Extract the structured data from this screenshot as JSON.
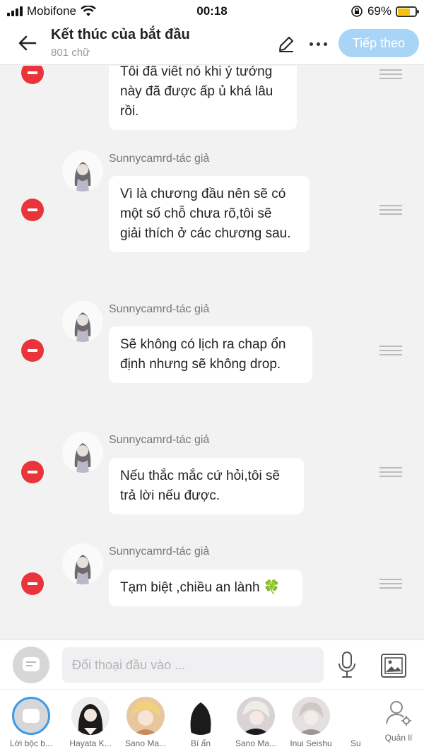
{
  "status_bar": {
    "carrier": "Mobifone",
    "time": "00:18",
    "battery": "69%",
    "battery_level": 0.69,
    "icons": [
      "signal-icon",
      "wifi-icon",
      "rotation-lock-icon",
      "battery-icon"
    ]
  },
  "header": {
    "title": "Kết thúc của bắt đầu",
    "subtitle": "801 chữ",
    "next_label": "Tiếp theo",
    "accent": "#a8d4f5"
  },
  "messages": [
    {
      "author": "",
      "lines": [
        "Tôi đã viết nó khi ý tưởng",
        "này đã được ấp ủ khá lâu",
        "rồi."
      ]
    },
    {
      "author": "Sunnycamrd-tác giả",
      "lines": [
        "Vì là chương đầu nên sẽ có",
        "một số chỗ chưa rõ,tôi sẽ",
        "giải thích ở các chương sau."
      ]
    },
    {
      "author": "Sunnycamrd-tác giả",
      "lines": [
        "Sẽ không có lịch ra chap ổn",
        "định nhưng sẽ không drop."
      ]
    },
    {
      "author": "Sunnycamrd-tác giả",
      "lines": [
        "Nếu thắc mắc cứ hỏi,tôi sẽ",
        "trả lời nếu được."
      ]
    },
    {
      "author": "Sunnycamrd-tác giả",
      "lines": [
        "Tạm biệt ,chiều an lành 🍀"
      ]
    }
  ],
  "input": {
    "placeholder": "Đối thoại đầu vào ..."
  },
  "characters": [
    {
      "name": "Lời bộc b..."
    },
    {
      "name": "Hayata K..."
    },
    {
      "name": "Sano Ma..."
    },
    {
      "name": "Bí ẩn"
    },
    {
      "name": "Sano Ma..."
    },
    {
      "name": "Inui Seishu"
    },
    {
      "name": "Su"
    }
  ],
  "manage_label": "Quản lí",
  "colors": {
    "delete": "#e8343a",
    "active_ring": "#3a9be8"
  }
}
